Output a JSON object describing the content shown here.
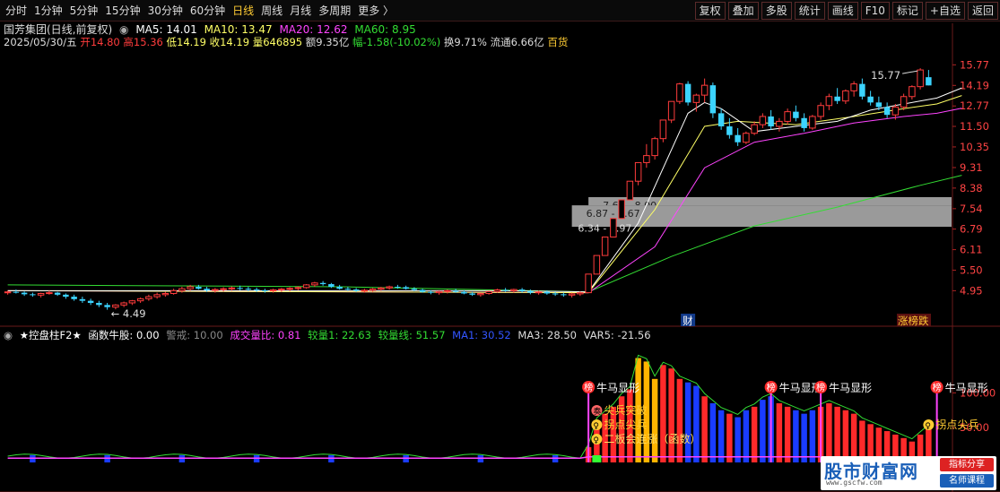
{
  "toolbar": {
    "timeframes": [
      {
        "label": "分时",
        "active": false
      },
      {
        "label": "1分钟",
        "active": false
      },
      {
        "label": "5分钟",
        "active": false
      },
      {
        "label": "15分钟",
        "active": false
      },
      {
        "label": "30分钟",
        "active": false
      },
      {
        "label": "60分钟",
        "active": false
      },
      {
        "label": "日线",
        "active": true
      },
      {
        "label": "周线",
        "active": false
      },
      {
        "label": "月线",
        "active": false
      },
      {
        "label": "多周期",
        "active": false
      },
      {
        "label": "更多 〉",
        "active": false
      }
    ],
    "right_buttons": [
      "复权",
      "叠加",
      "多股",
      "统计",
      "画线",
      "F10",
      "标记",
      "+自选",
      "返回"
    ]
  },
  "quote": {
    "title": "国芳集团(日线,前复权)",
    "ma5": "MA5: 14.01",
    "ma10": "MA10: 13.47",
    "ma20": "MA20: 12.62",
    "ma60": "MA60: 8.95",
    "date": "2025/05/30/五",
    "open": "开14.80",
    "high": "高15.36",
    "low": "低14.19",
    "close": "收14.19",
    "volume": "量646895",
    "amount": "额9.35亿",
    "change": "幅-1.58(-10.02%)",
    "turnover": "换9.71%",
    "float": "流通6.66亿",
    "sector": "百货"
  },
  "indicator": {
    "name": "★控盘柱F2★",
    "func": "函数牛股: 0.00",
    "alert": "警戒: 10.00",
    "vr": "成交量比: 0.81",
    "vol1": "较量1: 22.63",
    "volline": "较量线: 51.57",
    "ma1": "MA1: 30.52",
    "ma3": "MA3: 28.50",
    "var5": "VAR5: -21.56"
  },
  "colors": {
    "up": "#ff3c3c",
    "down": "#3cd4ff",
    "ma5": "#ffffff",
    "ma10": "#ffff66",
    "ma20": "#ff44ff",
    "ma60": "#33dd33",
    "blue_bar": "#1a3cff",
    "orange_bar": "#ffb400"
  },
  "price_axis": {
    "labels": [
      "15.77",
      "14.19",
      "12.77",
      "11.50",
      "10.35",
      "9.31",
      "8.38",
      "7.54",
      "6.79",
      "6.11",
      "5.50",
      "4.95"
    ],
    "min": 4.4,
    "max": 17.0,
    "log": true
  },
  "sub_axis": {
    "labels": [
      "100.00",
      "50.00"
    ],
    "min": 0,
    "max": 170
  },
  "annotations": {
    "high_price": "15.77",
    "low_price": "4.49",
    "zones": [
      "7.67 - 8.00",
      "6.87 - 7.67",
      "6.34 - 6.97"
    ],
    "cai_label": "财",
    "tags_label": "涨榜跌",
    "signals": [
      {
        "icon": "榜",
        "text": "牛马显形"
      },
      {
        "icon": "榜",
        "text": "牛马显形"
      },
      {
        "icon": "榜",
        "text": "牛马显形"
      },
      {
        "icon": "榜",
        "text": "牛马显形"
      }
    ],
    "sub_signals": [
      {
        "icon": "奏",
        "text": "尖兵突破"
      },
      {
        "icon": "♀",
        "text": "拐点尖兵"
      },
      {
        "icon": "♀",
        "text": "二板会连涨（函数）"
      },
      {
        "icon": "♀",
        "text": "拐点尖兵"
      }
    ]
  },
  "chart_data": {
    "type": "candlestick",
    "candles": [
      [
        4.9,
        4.95,
        4.85,
        4.92
      ],
      [
        4.92,
        4.98,
        4.88,
        4.9
      ],
      [
        4.9,
        4.93,
        4.82,
        4.86
      ],
      [
        4.86,
        4.9,
        4.8,
        4.84
      ],
      [
        4.84,
        4.9,
        4.78,
        4.88
      ],
      [
        4.88,
        4.95,
        4.85,
        4.9
      ],
      [
        4.9,
        4.92,
        4.82,
        4.85
      ],
      [
        4.85,
        4.88,
        4.75,
        4.8
      ],
      [
        4.8,
        4.85,
        4.7,
        4.74
      ],
      [
        4.74,
        4.8,
        4.65,
        4.7
      ],
      [
        4.7,
        4.75,
        4.6,
        4.65
      ],
      [
        4.65,
        4.7,
        4.55,
        4.6
      ],
      [
        4.6,
        4.65,
        4.49,
        4.55
      ],
      [
        4.55,
        4.62,
        4.5,
        4.6
      ],
      [
        4.6,
        4.68,
        4.55,
        4.65
      ],
      [
        4.65,
        4.72,
        4.6,
        4.7
      ],
      [
        4.7,
        4.78,
        4.65,
        4.75
      ],
      [
        4.75,
        4.85,
        4.7,
        4.8
      ],
      [
        4.8,
        4.9,
        4.75,
        4.85
      ],
      [
        4.85,
        4.92,
        4.8,
        4.88
      ],
      [
        4.88,
        5.0,
        4.85,
        4.95
      ],
      [
        4.95,
        5.05,
        4.9,
        5.0
      ],
      [
        5.0,
        5.1,
        4.95,
        5.05
      ],
      [
        5.05,
        5.1,
        4.98,
        5.0
      ],
      [
        5.0,
        5.05,
        4.92,
        4.96
      ],
      [
        4.96,
        5.02,
        4.9,
        4.98
      ],
      [
        4.98,
        5.04,
        4.93,
        5.0
      ],
      [
        5.0,
        5.06,
        4.95,
        5.02
      ],
      [
        5.02,
        5.08,
        4.96,
        5.0
      ],
      [
        5.0,
        5.05,
        4.94,
        4.98
      ],
      [
        4.98,
        5.03,
        4.92,
        4.96
      ],
      [
        4.96,
        5.0,
        4.9,
        4.95
      ],
      [
        4.95,
        5.0,
        4.9,
        4.97
      ],
      [
        4.97,
        5.02,
        4.92,
        4.99
      ],
      [
        4.99,
        5.04,
        4.94,
        5.01
      ],
      [
        5.01,
        5.06,
        4.96,
        5.03
      ],
      [
        5.03,
        5.12,
        5.0,
        5.1
      ],
      [
        5.1,
        5.18,
        5.05,
        5.15
      ],
      [
        5.15,
        5.2,
        5.08,
        5.12
      ],
      [
        5.12,
        5.15,
        5.02,
        5.05
      ],
      [
        5.05,
        5.1,
        4.98,
        5.0
      ],
      [
        5.0,
        5.05,
        4.95,
        4.98
      ],
      [
        4.98,
        5.02,
        4.92,
        4.95
      ],
      [
        4.95,
        5.0,
        4.9,
        4.96
      ],
      [
        4.96,
        5.02,
        4.92,
        4.99
      ],
      [
        4.99,
        5.05,
        4.95,
        5.02
      ],
      [
        5.02,
        5.08,
        4.98,
        5.05
      ],
      [
        5.05,
        5.1,
        5.0,
        5.04
      ],
      [
        5.04,
        5.08,
        4.98,
        5.0
      ],
      [
        5.0,
        5.04,
        4.94,
        4.97
      ],
      [
        4.97,
        5.0,
        4.9,
        4.92
      ],
      [
        4.92,
        4.96,
        4.86,
        4.9
      ],
      [
        4.9,
        4.95,
        4.85,
        4.93
      ],
      [
        4.93,
        4.98,
        4.88,
        4.95
      ],
      [
        4.95,
        5.0,
        4.9,
        4.92
      ],
      [
        4.92,
        4.96,
        4.86,
        4.88
      ],
      [
        4.88,
        4.92,
        4.82,
        4.85
      ],
      [
        4.85,
        4.9,
        4.8,
        4.88
      ],
      [
        4.88,
        4.95,
        4.85,
        4.93
      ],
      [
        4.93,
        5.0,
        4.9,
        4.97
      ],
      [
        4.97,
        5.02,
        4.92,
        4.95
      ],
      [
        4.95,
        5.0,
        4.9,
        4.98
      ],
      [
        4.98,
        5.02,
        4.9,
        4.94
      ],
      [
        4.94,
        4.98,
        4.86,
        4.9
      ],
      [
        4.9,
        4.95,
        4.85,
        4.92
      ],
      [
        4.92,
        4.96,
        4.85,
        4.88
      ],
      [
        4.88,
        4.92,
        4.82,
        4.86
      ],
      [
        4.86,
        4.9,
        4.8,
        4.84
      ],
      [
        4.84,
        4.9,
        4.78,
        4.87
      ],
      [
        4.87,
        4.93,
        4.82,
        4.9
      ],
      [
        4.9,
        5.39,
        4.9,
        5.39
      ],
      [
        5.39,
        5.93,
        5.39,
        5.93
      ],
      [
        5.93,
        6.52,
        5.93,
        6.52
      ],
      [
        6.52,
        7.17,
        6.52,
        7.17
      ],
      [
        7.17,
        7.89,
        7.17,
        7.89
      ],
      [
        7.89,
        8.68,
        7.89,
        8.68
      ],
      [
        8.68,
        9.55,
        8.5,
        9.55
      ],
      [
        9.55,
        10.5,
        9.3,
        9.9
      ],
      [
        9.9,
        10.9,
        9.7,
        10.8
      ],
      [
        10.8,
        11.9,
        10.6,
        11.88
      ],
      [
        11.88,
        13.07,
        11.7,
        13.07
      ],
      [
        13.07,
        14.38,
        12.9,
        14.3
      ],
      [
        14.3,
        14.5,
        12.8,
        13.0
      ],
      [
        13.0,
        13.6,
        12.4,
        13.5
      ],
      [
        13.5,
        14.7,
        13.0,
        14.2
      ],
      [
        14.2,
        14.4,
        12.0,
        12.3
      ],
      [
        12.3,
        12.6,
        11.3,
        11.5
      ],
      [
        11.5,
        12.0,
        10.8,
        11.0
      ],
      [
        11.0,
        11.4,
        10.4,
        10.6
      ],
      [
        10.6,
        11.2,
        10.5,
        11.1
      ],
      [
        11.1,
        11.8,
        11.0,
        11.6
      ],
      [
        11.6,
        12.3,
        11.4,
        12.1
      ],
      [
        12.1,
        12.5,
        11.3,
        11.5
      ],
      [
        11.5,
        12.0,
        11.2,
        11.8
      ],
      [
        11.8,
        12.6,
        11.6,
        12.4
      ],
      [
        12.4,
        12.8,
        11.8,
        12.0
      ],
      [
        12.0,
        12.3,
        11.2,
        11.4
      ],
      [
        11.4,
        12.2,
        11.3,
        12.1
      ],
      [
        12.1,
        13.0,
        11.9,
        12.8
      ],
      [
        12.8,
        13.6,
        12.5,
        13.4
      ],
      [
        13.4,
        14.0,
        12.9,
        13.1
      ],
      [
        13.1,
        13.9,
        12.9,
        13.8
      ],
      [
        13.8,
        14.5,
        13.4,
        14.3
      ],
      [
        14.3,
        14.7,
        13.2,
        13.4
      ],
      [
        13.4,
        13.8,
        12.8,
        13.0
      ],
      [
        13.0,
        13.4,
        12.5,
        12.7
      ],
      [
        12.7,
        13.0,
        12.0,
        12.2
      ],
      [
        12.2,
        12.9,
        11.9,
        12.7
      ],
      [
        12.7,
        13.6,
        12.5,
        13.4
      ],
      [
        13.4,
        14.2,
        13.2,
        14.1
      ],
      [
        14.1,
        15.5,
        13.9,
        15.36
      ],
      [
        14.8,
        15.36,
        14.19,
        14.19
      ]
    ],
    "ma5": [
      [
        0,
        4.95
      ],
      [
        60,
        4.95
      ],
      [
        70,
        4.92
      ],
      [
        76,
        7.0
      ],
      [
        82,
        12.3
      ],
      [
        84,
        13.0
      ],
      [
        86,
        12.6
      ],
      [
        90,
        11.2
      ],
      [
        95,
        11.5
      ],
      [
        100,
        11.8
      ],
      [
        104,
        12.5
      ],
      [
        108,
        12.9
      ],
      [
        112,
        13.3
      ],
      [
        115,
        14.01
      ]
    ],
    "ma10": [
      [
        0,
        4.95
      ],
      [
        70,
        4.9
      ],
      [
        78,
        7.5
      ],
      [
        84,
        11.5
      ],
      [
        88,
        11.8
      ],
      [
        95,
        11.6
      ],
      [
        102,
        12.1
      ],
      [
        108,
        12.6
      ],
      [
        112,
        12.9
      ],
      [
        115,
        13.47
      ]
    ],
    "ma20": [
      [
        0,
        4.95
      ],
      [
        70,
        4.9
      ],
      [
        78,
        6.2
      ],
      [
        84,
        9.3
      ],
      [
        90,
        10.6
      ],
      [
        96,
        11.1
      ],
      [
        102,
        11.7
      ],
      [
        108,
        12.1
      ],
      [
        112,
        12.3
      ],
      [
        115,
        12.62
      ]
    ],
    "ma60": [
      [
        0,
        5.1
      ],
      [
        40,
        5.05
      ],
      [
        70,
        4.92
      ],
      [
        80,
        5.9
      ],
      [
        90,
        6.9
      ],
      [
        100,
        7.6
      ],
      [
        110,
        8.5
      ],
      [
        115,
        8.95
      ]
    ]
  }
}
